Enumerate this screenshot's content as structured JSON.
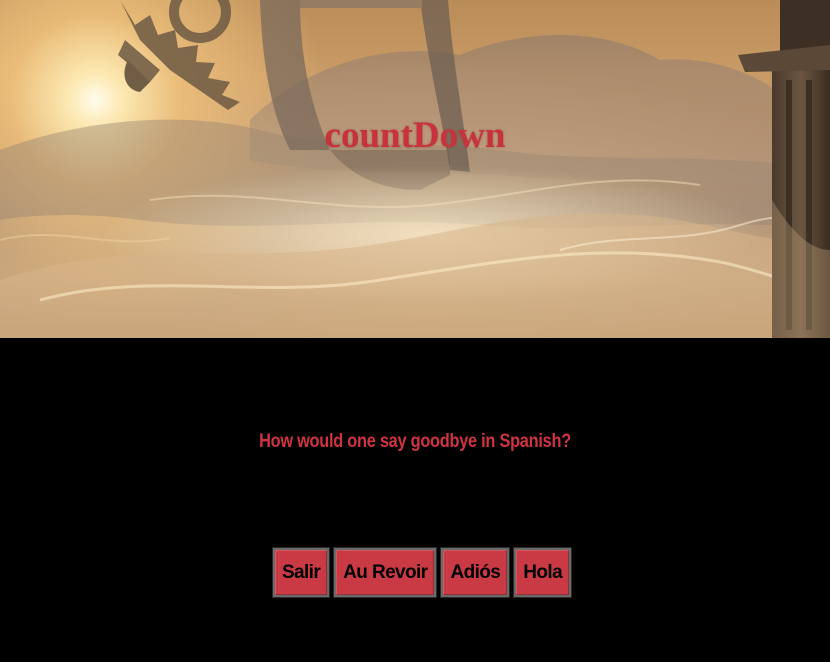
{
  "game": {
    "title": "countDown",
    "question": "How would one say goodbye in Spanish?",
    "answers": [
      {
        "label": "Salir"
      },
      {
        "label": "Au Revoir"
      },
      {
        "label": "Adiós"
      },
      {
        "label": "Hola"
      }
    ]
  },
  "colors": {
    "accent": "#c93a45",
    "background": "#000000",
    "answer_text": "#000000"
  },
  "banner": {
    "image": "fantasy-sky-clock-scene"
  }
}
